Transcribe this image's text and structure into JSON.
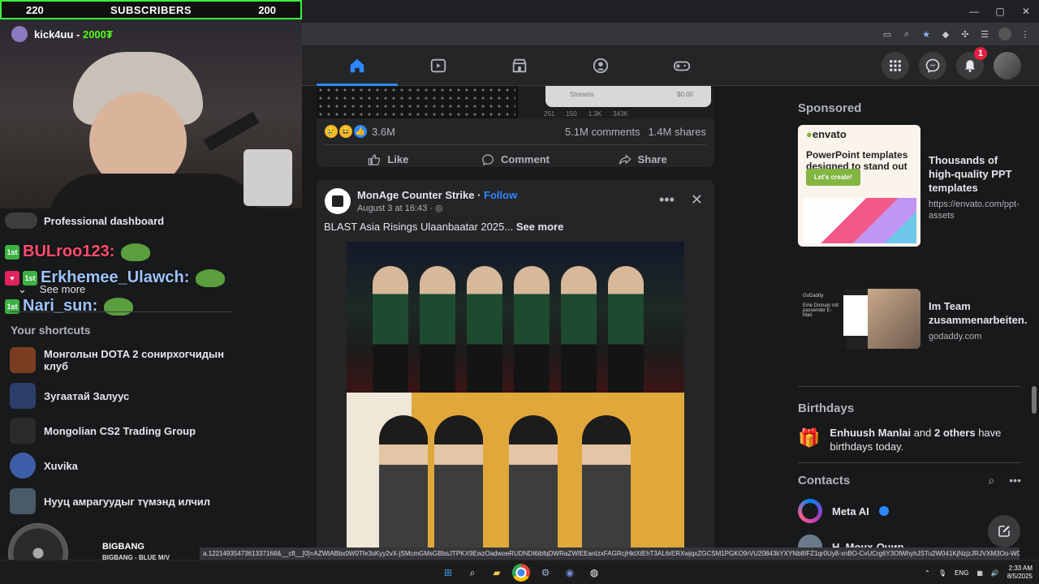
{
  "stream": {
    "sub_left": "220",
    "sub_title": "SUBSCRIBERS",
    "sub_right": "200",
    "kick_user": "kick4uu - ",
    "kick_amount": "2000₮"
  },
  "chat": [
    {
      "user": "BULroo123:",
      "badge": "1st"
    },
    {
      "user": "Erkhemee_Ulawch:",
      "badge": "1st"
    },
    {
      "user": "Nari_sun:",
      "badge": "1st"
    }
  ],
  "sidebar": {
    "professional_dashboard": "Professional dashboard",
    "see_more": "See more",
    "shortcuts_title": "Your shortcuts",
    "shortcuts": [
      {
        "label": "Монголын DOTA 2 сонирхогчидын клуб",
        "color": "#7a3d22"
      },
      {
        "label": "Зугаатай Залуус",
        "color": "#2c3e6b"
      },
      {
        "label": "Mongolian CS2 Trading Group",
        "color": "#2a2a2a"
      },
      {
        "label": "Xuvika",
        "color": "#3e5fa8"
      },
      {
        "label": "Нууц амрагуудыг түмэнд илчил",
        "color": "#4a5a6a"
      }
    ]
  },
  "music": {
    "title": "BIGBANG",
    "subtitle": "BIGBANG - BLUE M/V"
  },
  "header": {
    "notifications_count": "1"
  },
  "post1": {
    "stream_label": "Streams",
    "stream_value": "$0.00",
    "stats": [
      "251",
      "150",
      "1.3K",
      "343K"
    ],
    "reactions": "3.6M",
    "comments": "5.1M comments",
    "shares": "1.4M shares",
    "like": "Like",
    "comment": "Comment",
    "share": "Share"
  },
  "post2": {
    "page_name": "MonAge Counter Strike",
    "dot": " · ",
    "follow": "Follow",
    "date": "August 3 at 16:43 · ",
    "text": "BLAST Asia Risings Ulaanbaatar 2025...",
    "see_more": "See more"
  },
  "right": {
    "sponsored": "Sponsored",
    "ad1": {
      "brand": "envato",
      "tagline": "PowerPoint templates designed to stand out",
      "cta": "Let's create!",
      "headline": "Thousands of high-quality PPT templates",
      "url": "https://envato.com/ppt-assets"
    },
    "ad2": {
      "brand_text": "GoDaddy",
      "left_text": "Eine Domain mit passender E-Mail.",
      "headline": "Im Team zusammenarbeiten.",
      "url": "godaddy.com"
    },
    "birthdays_title": "Birthdays",
    "birthday_name": "Enhuush Manlai",
    "birthday_and": " and ",
    "birthday_others": "2 others",
    "birthday_tail": " have birthdays today.",
    "contacts_title": "Contacts",
    "contacts": [
      {
        "name": "Meta AI"
      },
      {
        "name": "Н. Мөнх-Очир"
      }
    ]
  },
  "status_url": "a.1221493547361337168&__cft__[0]=AZWtABbx0W0Tfe3sKyy2vX-jSMcmGMsGBbsJTPKX9EwzOadwoeRUDNDI6ibfqDWRaZWIEEanIzxFAGRcjHktXtEhT3AL6rERXwjqxZGCSM1PGKO9rVU20843kYXYNb8IFZ1qr0Uy8-xnBO-CvUCrg6Y3OlWhyhJSTu2W041KjNzjzJRJVXM3Oo-W0AbIFpoOWpsW...",
  "taskbar": {
    "lang": "ENG",
    "time": "2:33 AM",
    "date": "8/5/2025",
    "discord_badge": "99+"
  }
}
